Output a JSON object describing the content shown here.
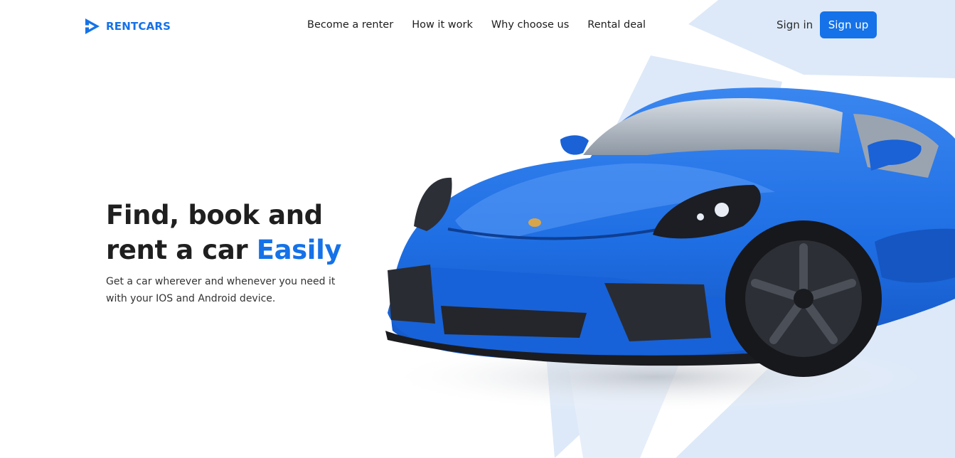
{
  "colors": {
    "accent": "#1572e8",
    "shape": "#dde9f8",
    "text": "#1f1f1f",
    "car_body": "#1f6fe4"
  },
  "brand": {
    "name": "RENTCARS",
    "icon": "play-triangle-logo-icon"
  },
  "nav": {
    "items": [
      {
        "label": "Become a renter"
      },
      {
        "label": "How it work"
      },
      {
        "label": "Why choose us"
      },
      {
        "label": "Rental deal"
      }
    ]
  },
  "auth": {
    "sign_in": "Sign in",
    "sign_up": "Sign up"
  },
  "hero": {
    "title_part1": "Find, book and",
    "title_part2": "rent a car ",
    "title_highlight": "Easily",
    "description": "Get a car wherever and whenever you need it with your IOS and Android device."
  },
  "image": {
    "subject": "blue sports car"
  }
}
